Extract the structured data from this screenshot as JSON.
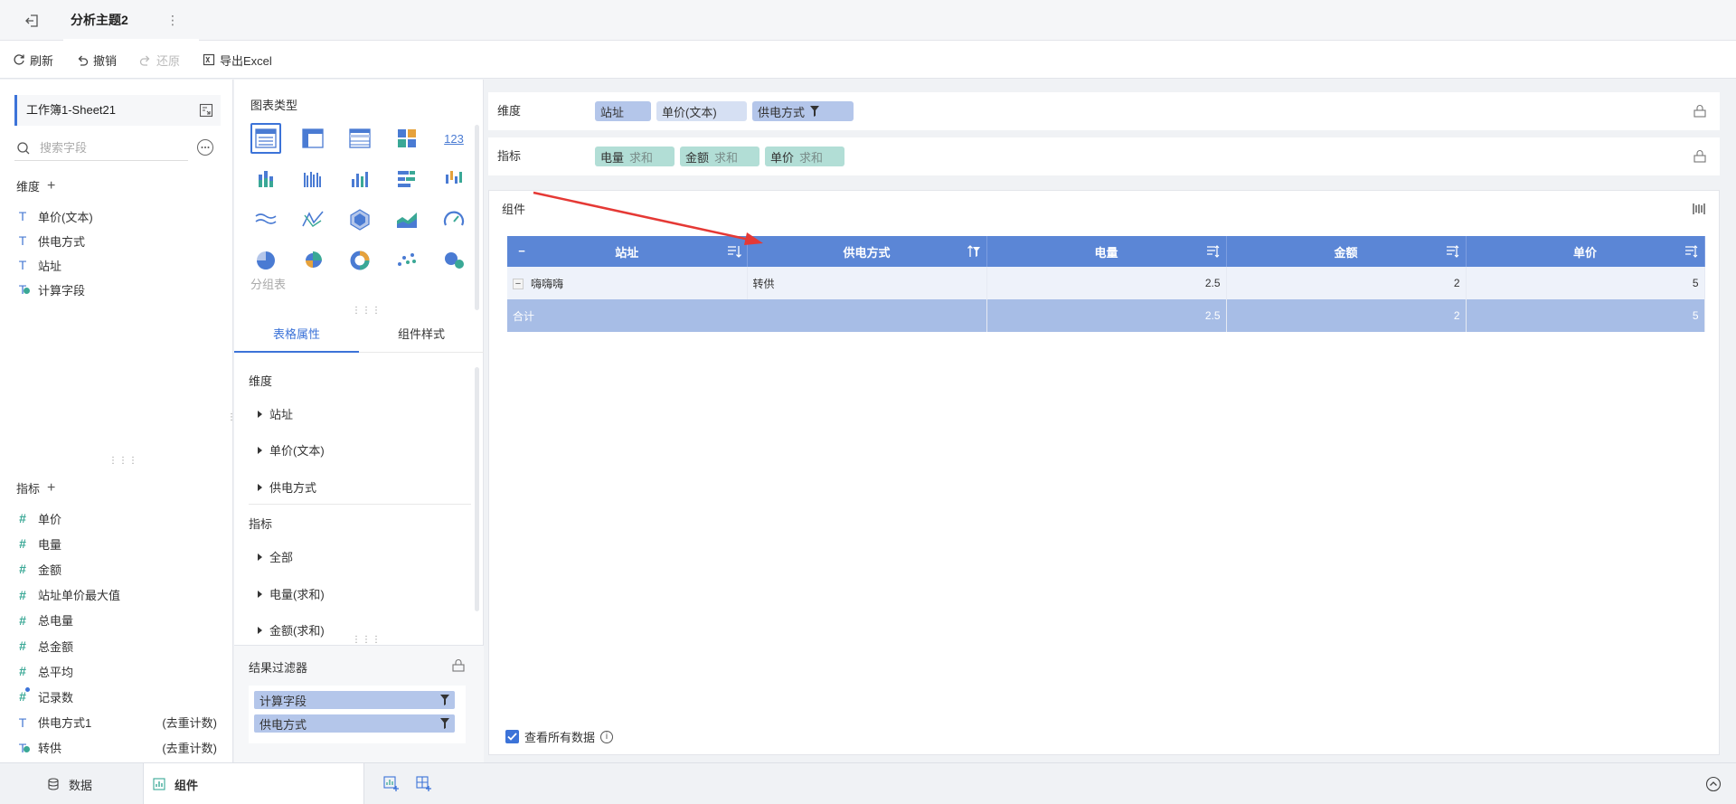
{
  "topbar": {
    "topic_tab": "分析主题2"
  },
  "toolbar": {
    "refresh": "刷新",
    "undo": "撤销",
    "redo": "还原",
    "export": "导出Excel"
  },
  "left": {
    "sheet_name": "工作簿1-Sheet21",
    "search_placeholder": "搜索字段",
    "dimension_title": "维度",
    "dimensions": [
      {
        "label": "单价(文本)",
        "icon": "text-field-icon"
      },
      {
        "label": "供电方式",
        "icon": "text-field-icon"
      },
      {
        "label": "站址",
        "icon": "text-field-icon"
      },
      {
        "label": "计算字段",
        "icon": "calculated-text-field-icon"
      }
    ],
    "measure_title": "指标",
    "measures": [
      {
        "label": "单价",
        "icon": "number-field-icon",
        "agg": ""
      },
      {
        "label": "电量",
        "icon": "number-field-icon",
        "agg": ""
      },
      {
        "label": "金额",
        "icon": "number-field-icon",
        "agg": ""
      },
      {
        "label": "站址单价最大值",
        "icon": "number-field-icon",
        "agg": ""
      },
      {
        "label": "总电量",
        "icon": "number-field-icon",
        "agg": ""
      },
      {
        "label": "总金额",
        "icon": "number-field-icon",
        "agg": ""
      },
      {
        "label": "总平均",
        "icon": "number-field-icon",
        "agg": ""
      },
      {
        "label": "记录数",
        "icon": "record-count-icon",
        "agg": ""
      },
      {
        "label": "供电方式1",
        "icon": "text-field-icon",
        "agg": "(去重计数)"
      },
      {
        "label": "转供",
        "icon": "calculated-text-field-icon",
        "agg": "(去重计数)"
      }
    ]
  },
  "middle": {
    "chart_type_title": "图表类型",
    "chart_types": [
      "grouped-table-icon",
      "detail-table-icon",
      "cross-table-icon",
      "multi-block-icon",
      "kpi-number-icon",
      "stacked-column-icon",
      "multi-column-icon",
      "column-chart-icon",
      "bar-chart-icon",
      "range-column-icon",
      "wave-line-icon",
      "polyline-icon",
      "radar-icon",
      "area-chart-icon",
      "gauge-icon",
      "pie-chart-icon",
      "rose-pie-icon",
      "donut-chart-icon",
      "scatter-icon",
      "bubble-icon"
    ],
    "chart_type_label": "123",
    "current_type_label": "分组表",
    "tabs": [
      "表格属性",
      "组件样式"
    ],
    "prop_dim_title": "维度",
    "prop_dims": [
      "站址",
      "单价(文本)",
      "供电方式"
    ],
    "prop_meas_title": "指标",
    "prop_meas": [
      "全部",
      "电量(求和)",
      "金额(求和)"
    ],
    "filter_title": "结果过滤器",
    "filters": [
      "计算字段",
      "供电方式"
    ]
  },
  "right": {
    "dim_shelf_label": "维度",
    "dim_pills": [
      "站址",
      "单价(文本)",
      "供电方式"
    ],
    "meas_shelf_label": "指标",
    "meas_pills": [
      {
        "name": "电量",
        "agg": "求和"
      },
      {
        "name": "金额",
        "agg": "求和"
      },
      {
        "name": "单价",
        "agg": "求和"
      }
    ],
    "component_title": "组件",
    "table": {
      "headers": [
        "站址",
        "供电方式",
        "电量",
        "金额",
        "单价"
      ],
      "rows": [
        {
          "station": "嗨嗨嗨",
          "supply": "转供",
          "power": "2.5",
          "amount": "2",
          "price": "5"
        }
      ],
      "total": {
        "label": "合计",
        "power": "2.5",
        "amount": "2",
        "price": "5"
      }
    },
    "view_all_label": "查看所有数据"
  },
  "bottom": {
    "data_tab": "数据",
    "component_tab": "组件"
  },
  "colors": {
    "accent": "#3c73d8",
    "header": "#5b86d6",
    "total_row": "#a7bde6",
    "dim_pill": "#b4c6ea",
    "measure_pill": "#b2ded6",
    "arrow": "#e53935"
  }
}
